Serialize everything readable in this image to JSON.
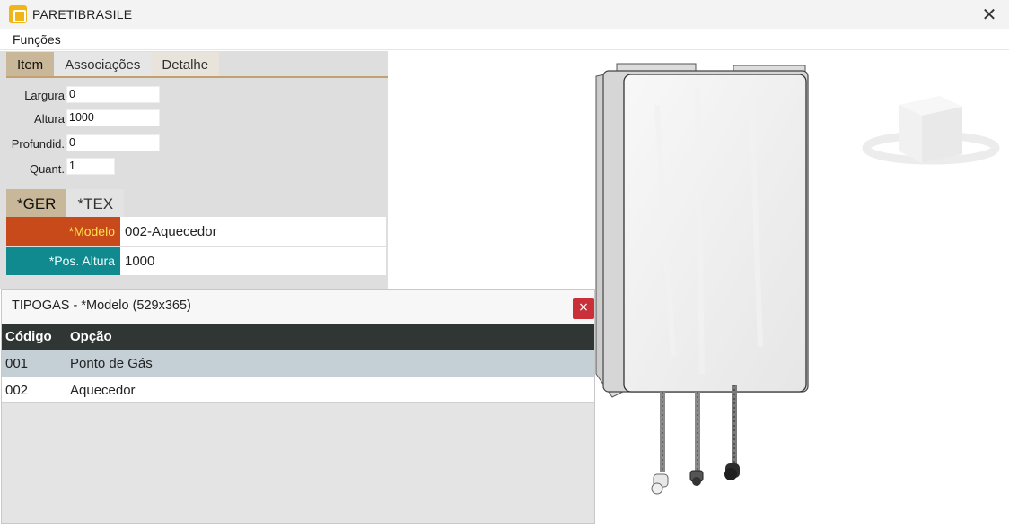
{
  "window": {
    "title": "PARETIBRASILE"
  },
  "menu": {
    "functions": "Funções"
  },
  "tabs_top": [
    "Item",
    "Associações",
    "Detalhe"
  ],
  "fields": {
    "largura": {
      "label": "Largura",
      "value": "0"
    },
    "altura": {
      "label": "Altura",
      "value": "1000"
    },
    "profundidade": {
      "label": "Profundid.",
      "value": "0"
    },
    "quantidade": {
      "label": "Quant.",
      "value": "1"
    }
  },
  "tabs_sub": [
    "*GER",
    "*TEX"
  ],
  "params": [
    {
      "key": "*Modelo",
      "value": "002-Aquecedor",
      "color": "#c84a1a"
    },
    {
      "key": "*Pos. Altura",
      "value": "1000",
      "color": "#118a8f"
    }
  ],
  "popup": {
    "title": "TIPOGAS - *Modelo (529x365)",
    "close": "×",
    "columns": [
      "Código",
      "Opção"
    ],
    "rows": [
      {
        "code": "001",
        "option": "Ponto de Gás"
      },
      {
        "code": "002",
        "option": "Aquecedor"
      }
    ]
  },
  "icons": {
    "app": "app-logo-icon",
    "close": "close-icon",
    "viewcube": "view-cube-icon"
  }
}
